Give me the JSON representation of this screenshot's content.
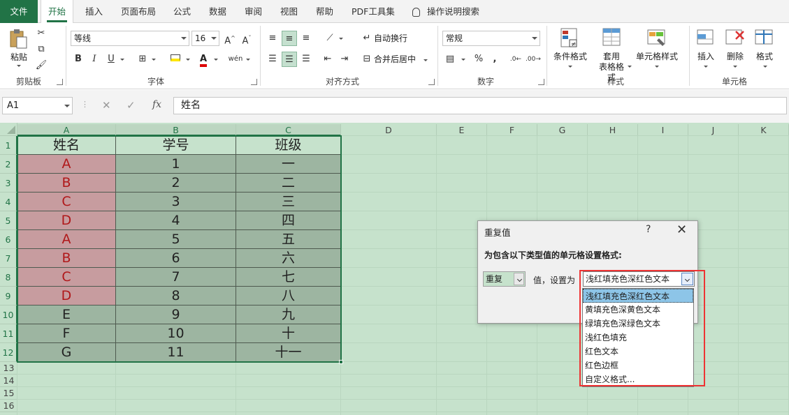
{
  "tabs": [
    "文件",
    "开始",
    "插入",
    "页面布局",
    "公式",
    "数据",
    "审阅",
    "视图",
    "帮助",
    "PDF工具集",
    "操作说明搜索"
  ],
  "active_tab": "开始",
  "ribbon": {
    "clipboard": {
      "paste": "粘贴",
      "group": "剪贴板"
    },
    "font": {
      "name": "等线",
      "size": "16",
      "bold": "B",
      "italic": "I",
      "underline": "U",
      "wen": "wén",
      "group": "字体"
    },
    "alignment": {
      "wrap": "自动换行",
      "merge": "合并后居中",
      "group": "对齐方式"
    },
    "number": {
      "format": "常规",
      "percent": "%",
      "comma": ",",
      "group": "数字"
    },
    "styles": {
      "cond": "条件格式",
      "table1": "套用",
      "table2": "表格格式",
      "cell": "单元格样式",
      "group": "样式"
    },
    "cells": {
      "insert": "插入",
      "delete": "删除",
      "format": "格式",
      "group": "单元格"
    }
  },
  "formula_bar": {
    "name_box": "A1",
    "fx": "fx",
    "content": "姓名"
  },
  "sheet": {
    "columns": [
      "A",
      "B",
      "C",
      "D",
      "E",
      "F",
      "G",
      "H",
      "I",
      "J",
      "K"
    ],
    "rows": [
      "1",
      "2",
      "3",
      "4",
      "5",
      "6",
      "7",
      "8",
      "9",
      "10",
      "11",
      "12",
      "13",
      "14",
      "15",
      "16"
    ],
    "header": [
      "姓名",
      "学号",
      "班级"
    ],
    "data": [
      [
        "A",
        "1",
        "一"
      ],
      [
        "B",
        "2",
        "二"
      ],
      [
        "C",
        "3",
        "三"
      ],
      [
        "D",
        "4",
        "四"
      ],
      [
        "A",
        "5",
        "五"
      ],
      [
        "B",
        "6",
        "六"
      ],
      [
        "C",
        "7",
        "七"
      ],
      [
        "D",
        "8",
        "八"
      ],
      [
        "E",
        "9",
        "九"
      ],
      [
        "F",
        "10",
        "十"
      ],
      [
        "G",
        "11",
        "十一"
      ]
    ],
    "duplicate_rows": 8
  },
  "dialog": {
    "title": "重复值",
    "help": "?",
    "close": "✕",
    "prompt": "为包含以下类型值的单元格设置格式:",
    "type_value": "重复",
    "middle_text": "值，设置为",
    "format_value": "浅红填充色深红色文本",
    "options": [
      "浅红填充色深红色文本",
      "黄填充色深黄色文本",
      "绿填充色深绿色文本",
      "浅红色填充",
      "红色文本",
      "红色边框",
      "自定义格式..."
    ]
  },
  "colors": {
    "excel_green": "#217346",
    "sheet_bg": "#c6e2cc",
    "dup_fill": "#c79c9f",
    "dup_text": "#b0181a",
    "highlight": "#e33"
  }
}
